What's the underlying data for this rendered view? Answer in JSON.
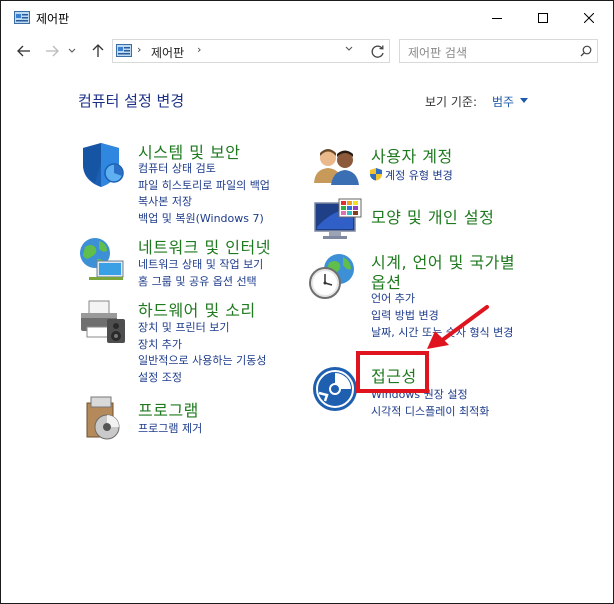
{
  "window": {
    "title": "제어판"
  },
  "address": {
    "path_item": "제어판"
  },
  "search": {
    "placeholder": "제어판 검색"
  },
  "header": {
    "page_title": "컴퓨터 설정 변경",
    "viewby_label": "보기 기준:",
    "viewby_value": "범주"
  },
  "categories": [
    {
      "title": "시스템 및 보안",
      "icon": "shield-icon",
      "links": [
        "컴퓨터 상태 검토",
        "파일 히스토리로 파일의 백업",
        "복사본 저장",
        "백업 및 복원(Windows 7)"
      ]
    },
    {
      "title": "네트워크 및 인터넷",
      "icon": "network-icon",
      "links": [
        "네트워크 상태 및 작업 보기",
        "홈 그룹 및 공유 옵션 선택"
      ]
    },
    {
      "title": "하드웨어 및 소리",
      "icon": "printer-icon",
      "links": [
        "장치 및 프린터 보기",
        "장치 추가",
        "일반적으로 사용하는 기동성",
        "설정 조정"
      ]
    },
    {
      "title": "프로그램",
      "icon": "programs-icon",
      "links": [
        "프로그램 제거"
      ]
    },
    {
      "title": "사용자 계정",
      "icon": "users-icon",
      "links": [
        "계정 유형 변경"
      ]
    },
    {
      "title": "모양 및 개인 설정",
      "icon": "monitor-icon",
      "links": []
    },
    {
      "title_line1": "시계, 언어 및 국가별",
      "title_line2": "옵션",
      "icon": "clock-globe-icon",
      "links": [
        "언어 추가",
        "입력 방법 변경",
        "날짜, 시간 또는 숫자 형식 변경"
      ]
    },
    {
      "title": "접근성",
      "icon": "accessibility-icon",
      "links": [
        "Windows 권장 설정",
        "시각적 디스플레이 최적화"
      ]
    }
  ],
  "colors": {
    "category_title": "#1f7a1f",
    "link": "#1e3c8c",
    "page_title": "#1e3287",
    "annotation": "#e0141e"
  }
}
